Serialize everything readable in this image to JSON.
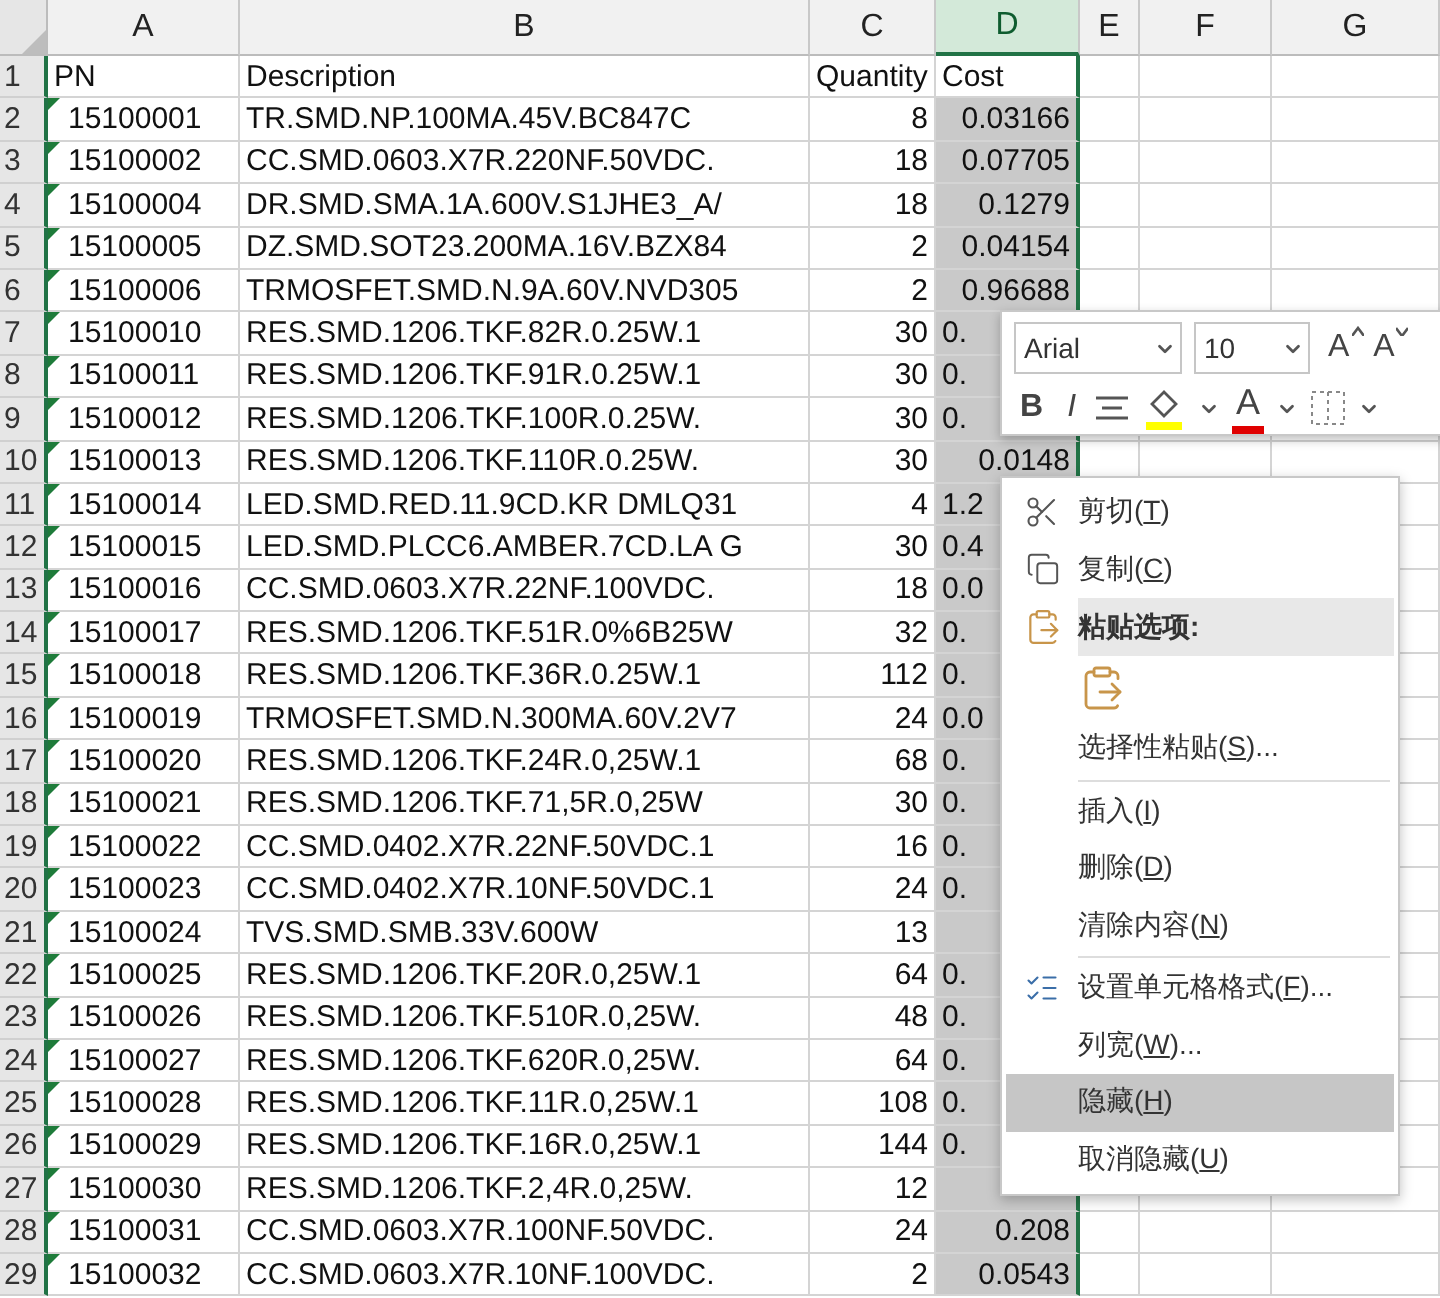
{
  "columns": [
    {
      "label": "A",
      "selected": false
    },
    {
      "label": "B",
      "selected": false
    },
    {
      "label": "C",
      "selected": false
    },
    {
      "label": "D",
      "selected": true
    },
    {
      "label": "E",
      "selected": false
    },
    {
      "label": "F",
      "selected": false
    },
    {
      "label": "G",
      "selected": false
    }
  ],
  "header_row": {
    "number": "1",
    "pn": "PN",
    "description": "Description",
    "quantity": "Quantity",
    "cost": "Cost"
  },
  "rows": [
    {
      "number": "2",
      "pn": "15100001",
      "description": "TR.SMD.NP.100MA.45V.BC847C",
      "quantity": "8",
      "cost": "0.03166",
      "marked": true
    },
    {
      "number": "3",
      "pn": "15100002",
      "description": "CC.SMD.0603.X7R.220NF.50VDC.",
      "quantity": "18",
      "cost": "0.07705",
      "marked": true
    },
    {
      "number": "4",
      "pn": "15100004",
      "description": "DR.SMD.SMA.1A.600V.S1JHE3_A/",
      "quantity": "18",
      "cost": "0.1279",
      "marked": true
    },
    {
      "number": "5",
      "pn": "15100005",
      "description": "DZ.SMD.SOT23.200MA.16V.BZX84",
      "quantity": "2",
      "cost": "0.04154",
      "marked": true
    },
    {
      "number": "6",
      "pn": "15100006",
      "description": "TRMOSFET.SMD.N.9A.60V.NVD305",
      "quantity": "2",
      "cost": "0.96688",
      "marked": true
    },
    {
      "number": "7",
      "pn": "15100010",
      "description": "RES.SMD.1206.TKF.82R.0.25W.1",
      "quantity": "30",
      "cost": "0.",
      "cut": true,
      "marked": true
    },
    {
      "number": "8",
      "pn": "15100011",
      "description": "RES.SMD.1206.TKF.91R.0.25W.1",
      "quantity": "30",
      "cost": "0.",
      "cut": true,
      "marked": true
    },
    {
      "number": "9",
      "pn": "15100012",
      "description": "RES.SMD.1206.TKF.100R.0.25W.",
      "quantity": "30",
      "cost": "0.",
      "cut": true,
      "marked": true
    },
    {
      "number": "10",
      "pn": "15100013",
      "description": "RES.SMD.1206.TKF.110R.0.25W.",
      "quantity": "30",
      "cost": "0.0148",
      "marked": true
    },
    {
      "number": "11",
      "pn": "15100014",
      "description": "LED.SMD.RED.11.9CD.KR DMLQ31",
      "quantity": "4",
      "cost": "1.2",
      "cut": true,
      "marked": true
    },
    {
      "number": "12",
      "pn": "15100015",
      "description": "LED.SMD.PLCC6.AMBER.7CD.LA G",
      "quantity": "30",
      "cost": "0.4",
      "cut": true,
      "marked": true
    },
    {
      "number": "13",
      "pn": "15100016",
      "description": "CC.SMD.0603.X7R.22NF.100VDC.",
      "quantity": "18",
      "cost": "0.0",
      "cut": true,
      "marked": true
    },
    {
      "number": "14",
      "pn": "15100017",
      "description": "RES.SMD.1206.TKF.51R.0%6B25W",
      "quantity": "32",
      "cost": "0.",
      "cut": true,
      "marked": true
    },
    {
      "number": "15",
      "pn": "15100018",
      "description": "RES.SMD.1206.TKF.36R.0.25W.1",
      "quantity": "112",
      "cost": "0.",
      "cut": true,
      "marked": true
    },
    {
      "number": "16",
      "pn": "15100019",
      "description": "TRMOSFET.SMD.N.300MA.60V.2V7",
      "quantity": "24",
      "cost": "0.0",
      "cut": true,
      "marked": true
    },
    {
      "number": "17",
      "pn": "15100020",
      "description": "RES.SMD.1206.TKF.24R.0,25W.1",
      "quantity": "68",
      "cost": "0.",
      "cut": true,
      "marked": true
    },
    {
      "number": "18",
      "pn": "15100021",
      "description": "RES.SMD.1206.TKF.71,5R.0,25W",
      "quantity": "30",
      "cost": "0.",
      "cut": true,
      "marked": true
    },
    {
      "number": "19",
      "pn": "15100022",
      "description": "CC.SMD.0402.X7R.22NF.50VDC.1",
      "quantity": "16",
      "cost": "0.",
      "cut": true,
      "marked": true
    },
    {
      "number": "20",
      "pn": "15100023",
      "description": "CC.SMD.0402.X7R.10NF.50VDC.1",
      "quantity": "24",
      "cost": "0.",
      "cut": true,
      "marked": true
    },
    {
      "number": "21",
      "pn": "15100024",
      "description": "TVS.SMD.SMB.33V.600W",
      "quantity": "13",
      "marked": true
    },
    {
      "number": "22",
      "pn": "15100025",
      "description": "RES.SMD.1206.TKF.20R.0,25W.1",
      "quantity": "64",
      "cost": "0.",
      "cut": true,
      "marked": true
    },
    {
      "number": "23",
      "pn": "15100026",
      "description": "RES.SMD.1206.TKF.510R.0,25W.",
      "quantity": "48",
      "cost": "0.",
      "cut": true,
      "marked": true
    },
    {
      "number": "24",
      "pn": "15100027",
      "description": "RES.SMD.1206.TKF.620R.0,25W.",
      "quantity": "64",
      "cost": "0.",
      "cut": true,
      "marked": true
    },
    {
      "number": "25",
      "pn": "15100028",
      "description": "RES.SMD.1206.TKF.11R.0,25W.1",
      "quantity": "108",
      "cost": "0.",
      "cut": true,
      "marked": true
    },
    {
      "number": "26",
      "pn": "15100029",
      "description": "RES.SMD.1206.TKF.16R.0,25W.1",
      "quantity": "144",
      "cost": "0.",
      "cut": true,
      "marked": true
    },
    {
      "number": "27",
      "pn": "15100030",
      "description": "RES.SMD.1206.TKF.2,4R.0,25W.",
      "quantity": "12",
      "marked": true
    },
    {
      "number": "28",
      "pn": "15100031",
      "description": "CC.SMD.0603.X7R.100NF.50VDC.",
      "quantity": "24",
      "cost": "0.208",
      "marked": true
    },
    {
      "number": "29",
      "pn": "15100032",
      "description": "CC.SMD.0603.X7R.10NF.100VDC.",
      "quantity": "2",
      "cost": "0.0543",
      "marked": true
    }
  ],
  "mini_toolbar": {
    "font": "Arial",
    "size": "10",
    "grow": "A",
    "shrink": "A",
    "bold": "B",
    "italic": "I",
    "font_color": "A"
  },
  "context_menu": [
    {
      "kind": "item",
      "before": "剪切(",
      "key": "T",
      "after": ")",
      "selected": false
    },
    {
      "kind": "item",
      "before": "复制(",
      "key": "C",
      "after": ")",
      "selected": false
    },
    {
      "kind": "header",
      "before": "粘贴选项:"
    },
    {
      "kind": "paste"
    },
    {
      "kind": "item",
      "before": "选择性粘贴(",
      "key": "S",
      "after": ")...",
      "selected": false
    },
    {
      "kind": "separator"
    },
    {
      "kind": "item",
      "before": "插入(",
      "key": "I",
      "after": ")",
      "selected": false
    },
    {
      "kind": "item",
      "before": "删除(",
      "key": "D",
      "after": ")",
      "selected": false
    },
    {
      "kind": "item",
      "before": "清除内容(",
      "key": "N",
      "after": ")",
      "selected": false
    },
    {
      "kind": "separator"
    },
    {
      "kind": "item",
      "before": "设置单元格格式(",
      "key": "F",
      "after": ")...",
      "selected": false
    },
    {
      "kind": "item",
      "before": "列宽(",
      "key": "W",
      "after": ")...",
      "selected": false
    },
    {
      "kind": "item",
      "before": "隐藏(",
      "key": "H",
      "after": ")",
      "selected": true
    },
    {
      "kind": "item",
      "before": "取消隐藏(",
      "key": "U",
      "after": ")",
      "selected": false
    }
  ]
}
